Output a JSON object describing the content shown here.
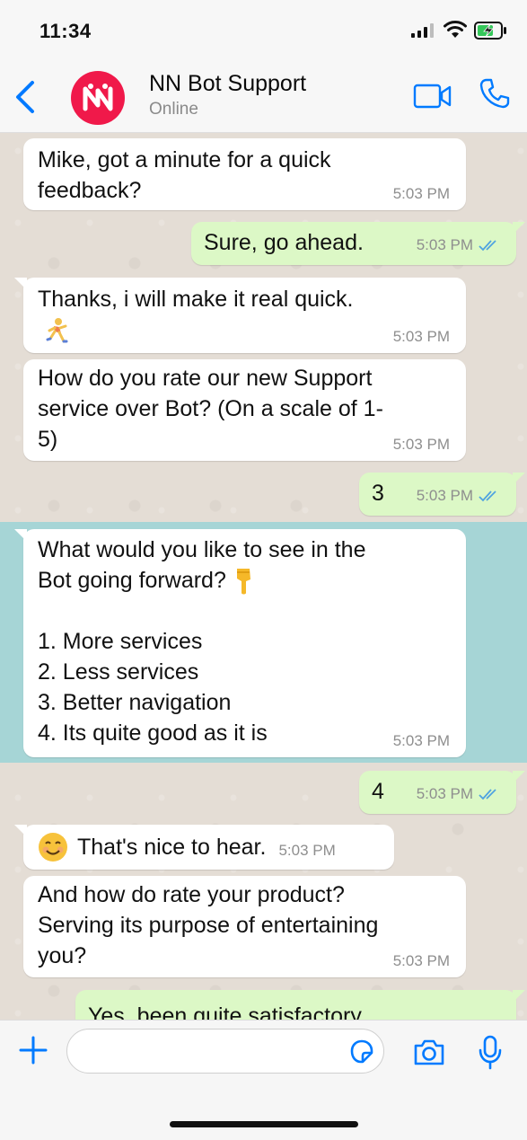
{
  "status_bar": {
    "time": "11:34"
  },
  "header": {
    "contact_name": "NN Bot Support",
    "contact_status": "Online",
    "avatar_letter": "N",
    "accent_color": "#007aff",
    "avatar_color": "#f0194a"
  },
  "messages": [
    {
      "direction": "in",
      "text": "Mike, got a minute for a quick\nfeedback?",
      "time": "5:03 PM"
    },
    {
      "direction": "out",
      "text": "Sure, go ahead.",
      "time": "5:03 PM",
      "read": true
    },
    {
      "direction": "in",
      "text": "Thanks, i will make it real quick.",
      "emoji": "runner",
      "time": "5:03 PM"
    },
    {
      "direction": "in",
      "text": "How do you rate our new Support\nservice over Bot? (On a scale of 1-\n5)",
      "time": "5:03 PM"
    },
    {
      "direction": "out",
      "text": "3",
      "time": "5:03 PM",
      "read": true
    },
    {
      "direction": "in",
      "text": "What would you like to see in the\nBot going forward?",
      "emoji": "pointing-down",
      "options": "1. More services\n2. Less services\n3. Better navigation\n4. Its quite good as it is",
      "time": "5:03 PM",
      "highlighted": true
    },
    {
      "direction": "out",
      "text": "4",
      "time": "5:03 PM",
      "read": true
    },
    {
      "direction": "in",
      "text": "That's nice to hear.",
      "emoji": "smiling-face",
      "time": "5:03 PM"
    },
    {
      "direction": "in",
      "text": "And how do rate your product?\nServing its purpose of entertaining\nyou?",
      "time": "5:03 PM"
    },
    {
      "direction": "out",
      "text": "Yes, been quite satisfactory.",
      "partial": true
    }
  ],
  "input_bar": {
    "placeholder": ""
  }
}
